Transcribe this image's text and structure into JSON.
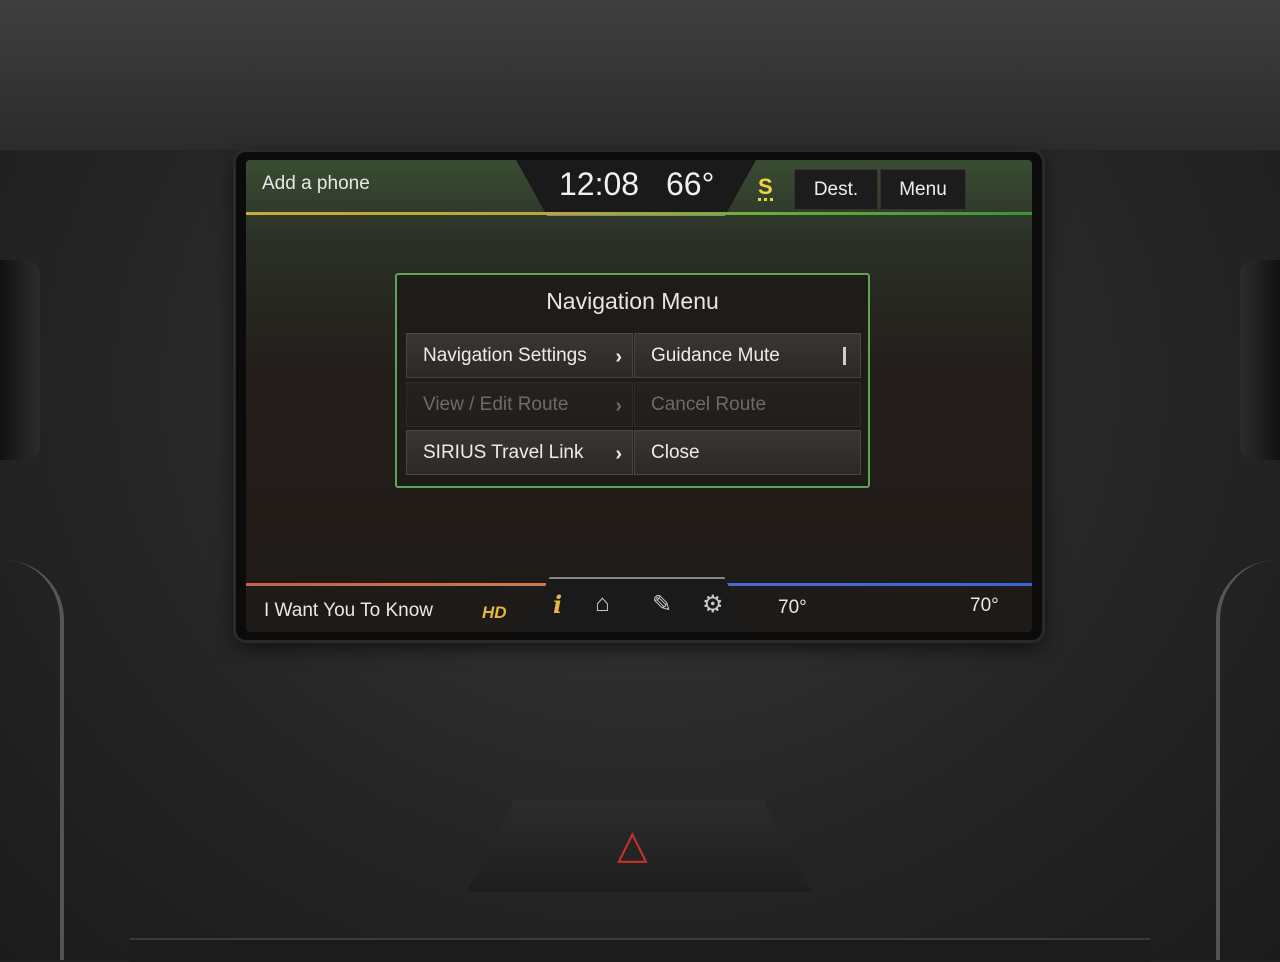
{
  "top_bar": {
    "phone_label": "Add a phone",
    "clock": "12:08",
    "outside_temp": "66°",
    "sirius_icon": "S",
    "dest_button": "Dest.",
    "menu_button": "Menu"
  },
  "nav_menu": {
    "title": "Navigation Menu",
    "items": [
      {
        "label": "Navigation Settings",
        "enabled": true,
        "chevron": "›"
      },
      {
        "label": "Guidance Mute",
        "enabled": true
      },
      {
        "label": "View / Edit Route",
        "enabled": false,
        "chevron": "›"
      },
      {
        "label": "Cancel Route",
        "enabled": false
      },
      {
        "label": "SIRIUS Travel Link",
        "enabled": true,
        "chevron": "›"
      },
      {
        "label": "Close",
        "enabled": true
      }
    ]
  },
  "bottom_bar": {
    "now_playing": "I Want You To Know",
    "hd_icon": "HD",
    "info_icon": "i",
    "home_icon": "⌂",
    "nav_icon": "✎",
    "gear_icon": "⚙",
    "temp_left": "70°",
    "temp_right": "70°"
  },
  "hazard": {
    "icon": "△",
    "color": "#c8302c"
  }
}
